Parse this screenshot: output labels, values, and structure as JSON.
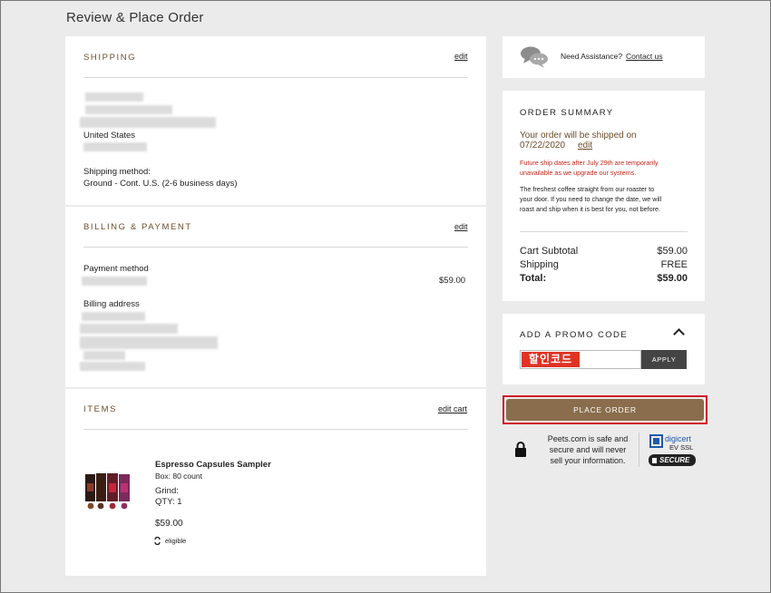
{
  "page": {
    "title": "Review & Place Order"
  },
  "shipping": {
    "heading": "SHIPPING",
    "edit_label": "edit",
    "country": "United States",
    "method_label": "Shipping method:",
    "method_value": "Ground - Cont. U.S. (2-6 business days)"
  },
  "billing": {
    "heading": "BILLING & PAYMENT",
    "edit_label": "edit",
    "payment_label": "Payment method",
    "amount": "$59.00",
    "address_label": "Billing address"
  },
  "items": {
    "heading": "ITEMS",
    "edit_label": "edit cart",
    "list": [
      {
        "name": "Espresso Capsules Sampler",
        "box": "Box: 80 count",
        "grind": "Grind:",
        "qty": "QTY: 1",
        "price": "$59.00",
        "eligible": "eligible"
      }
    ]
  },
  "assistance": {
    "text": "Need Assistance?",
    "link": "Contact us"
  },
  "summary": {
    "heading": "ORDER SUMMARY",
    "ship_line": "Your order will be shipped on",
    "ship_date": "07/22/2020",
    "edit_label": "edit",
    "notice_1": "Future ship dates after July 29th are temporarily",
    "notice_2": "unavailable as we upgrade our systems.",
    "desc_1": "The freshest coffee straight from our roaster to",
    "desc_2": "your door. If you need to change the date, we will",
    "desc_3": "roast and ship when it is best for you, not before.",
    "subtotal_label": "Cart Subtotal",
    "subtotal_value": "$59.00",
    "shipping_label": "Shipping",
    "shipping_value": "FREE",
    "total_label": "Total:",
    "total_value": "$59.00"
  },
  "promo": {
    "heading": "ADD A PROMO CODE",
    "input_value": "할인코드",
    "apply_label": "APPLY"
  },
  "order_button": {
    "label": "PLACE ORDER"
  },
  "security": {
    "line_1": "Peets.com is safe and",
    "line_2": "secure and will never",
    "line_3": "sell your information.",
    "badge_brand": "digicert",
    "badge_sub": "EV SSL",
    "badge_secure": "SECURE"
  },
  "colors": {
    "accent_brown": "#8a6d4c",
    "notice_red": "#c8271a",
    "highlight": "#d2172a"
  }
}
